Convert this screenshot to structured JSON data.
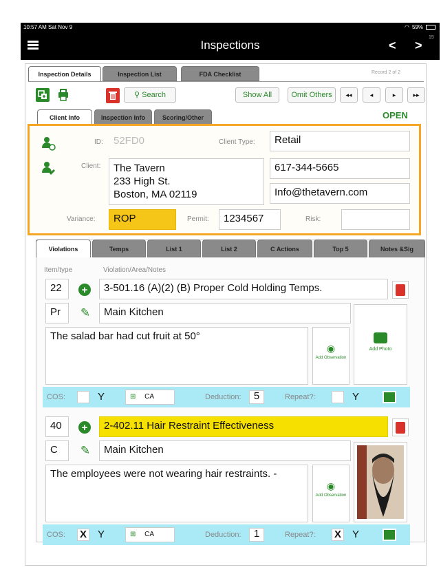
{
  "status": {
    "time": "10:57 AM  Sat Nov 9",
    "battery": "59%"
  },
  "nav": {
    "title": "Inspections",
    "back": "<",
    "forward": ">",
    "badge": "15"
  },
  "main_tabs": [
    "Inspection Details",
    "Inspection List",
    "FDA Checklist"
  ],
  "record": "Record 2 of 2",
  "toolbar": {
    "search": "Search",
    "show_all": "Show All",
    "omit_others": "Omit Others",
    "first": "◂◂",
    "prev": "◂",
    "next": "▸",
    "last": "▸▸"
  },
  "sub_tabs": [
    "Client Info",
    "Inspection Info",
    "Scoring/Other"
  ],
  "status_label": "OPEN",
  "client": {
    "id_label": "ID:",
    "id_value": "52FD0",
    "type_label": "Client Type:",
    "type_value": "Retail",
    "client_label": "Client:",
    "client_name": "The Tavern",
    "client_addr1": "233 High St.",
    "client_addr2": "Boston, MA  02119",
    "phone": "617-344-5665",
    "email": "Info@thetavern.com",
    "variance_label": "Variance:",
    "variance_value": "ROP",
    "permit_label": "Permit:",
    "permit_value": "1234567",
    "risk_label": "Risk:",
    "risk_value": ""
  },
  "violation_tabs": [
    "Violations",
    "Temps",
    "List 1",
    "List 2",
    "C Actions",
    "Top 5",
    "Notes &Sig"
  ],
  "headers": {
    "item": "Item/type",
    "notes": "Violation/Area/Notes"
  },
  "violations": [
    {
      "item": "22",
      "type": "Pr",
      "title": "3-501.16 (A)(2) (B) Proper Cold Holding Temps.",
      "area": "Main Kitchen",
      "note": "The salad bar had cut fruit at 50°",
      "add_obs": "Add Observation",
      "add_photo": "Add Photo",
      "cos_label": "COS:",
      "cos": "",
      "y": "Y",
      "ca": "CA",
      "deduction_label": "Deduction:",
      "deduction": "5",
      "repeat_label": "Repeat?:",
      "repeat": "",
      "ry": "Y"
    },
    {
      "item": "40",
      "type": "C",
      "title": "2-402.11 Hair Restraint Effectiveness",
      "area": "Main Kitchen",
      "note": "The employees were not wearing hair restraints. -",
      "add_obs": "Add Observation",
      "cos_label": "COS:",
      "cos": "X",
      "y": "Y",
      "ca": "CA",
      "deduction_label": "Deduction:",
      "deduction": "1",
      "repeat_label": "Repeat?:",
      "repeat": "X",
      "ry": "Y"
    }
  ],
  "colors": {
    "accent": "#2a8a2a",
    "highlight": "#f5e000",
    "orange": "#f5a623",
    "cyan": "#aaeaf7",
    "delete": "#d9322b"
  }
}
